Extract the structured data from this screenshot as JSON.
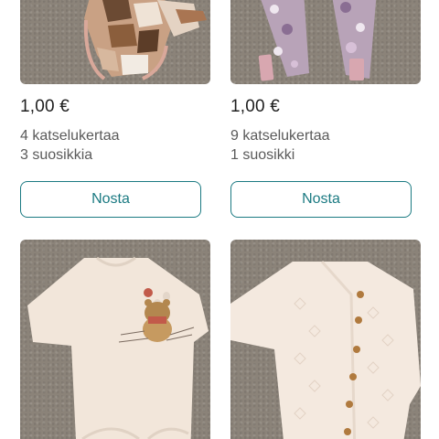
{
  "listings": [
    {
      "image": "patterned baby bodysuit",
      "price": "1,00 €",
      "views": "4 katselukertaa",
      "favorites": "3 suosikkia",
      "boost_label": "Nosta"
    },
    {
      "image": "floral leggings",
      "price": "1,00 €",
      "views": "9 katselukertaa",
      "favorites": "1 suosikki",
      "boost_label": "Nosta"
    },
    {
      "image": "bear print long-sleeve bodysuit"
    },
    {
      "image": "pointelle knit cardigan"
    }
  ],
  "colors": {
    "accent": "#1b7a82",
    "price_text": "#1f1f1f",
    "meta_text": "#5a5a5a",
    "photo_background": "#8b8379"
  }
}
